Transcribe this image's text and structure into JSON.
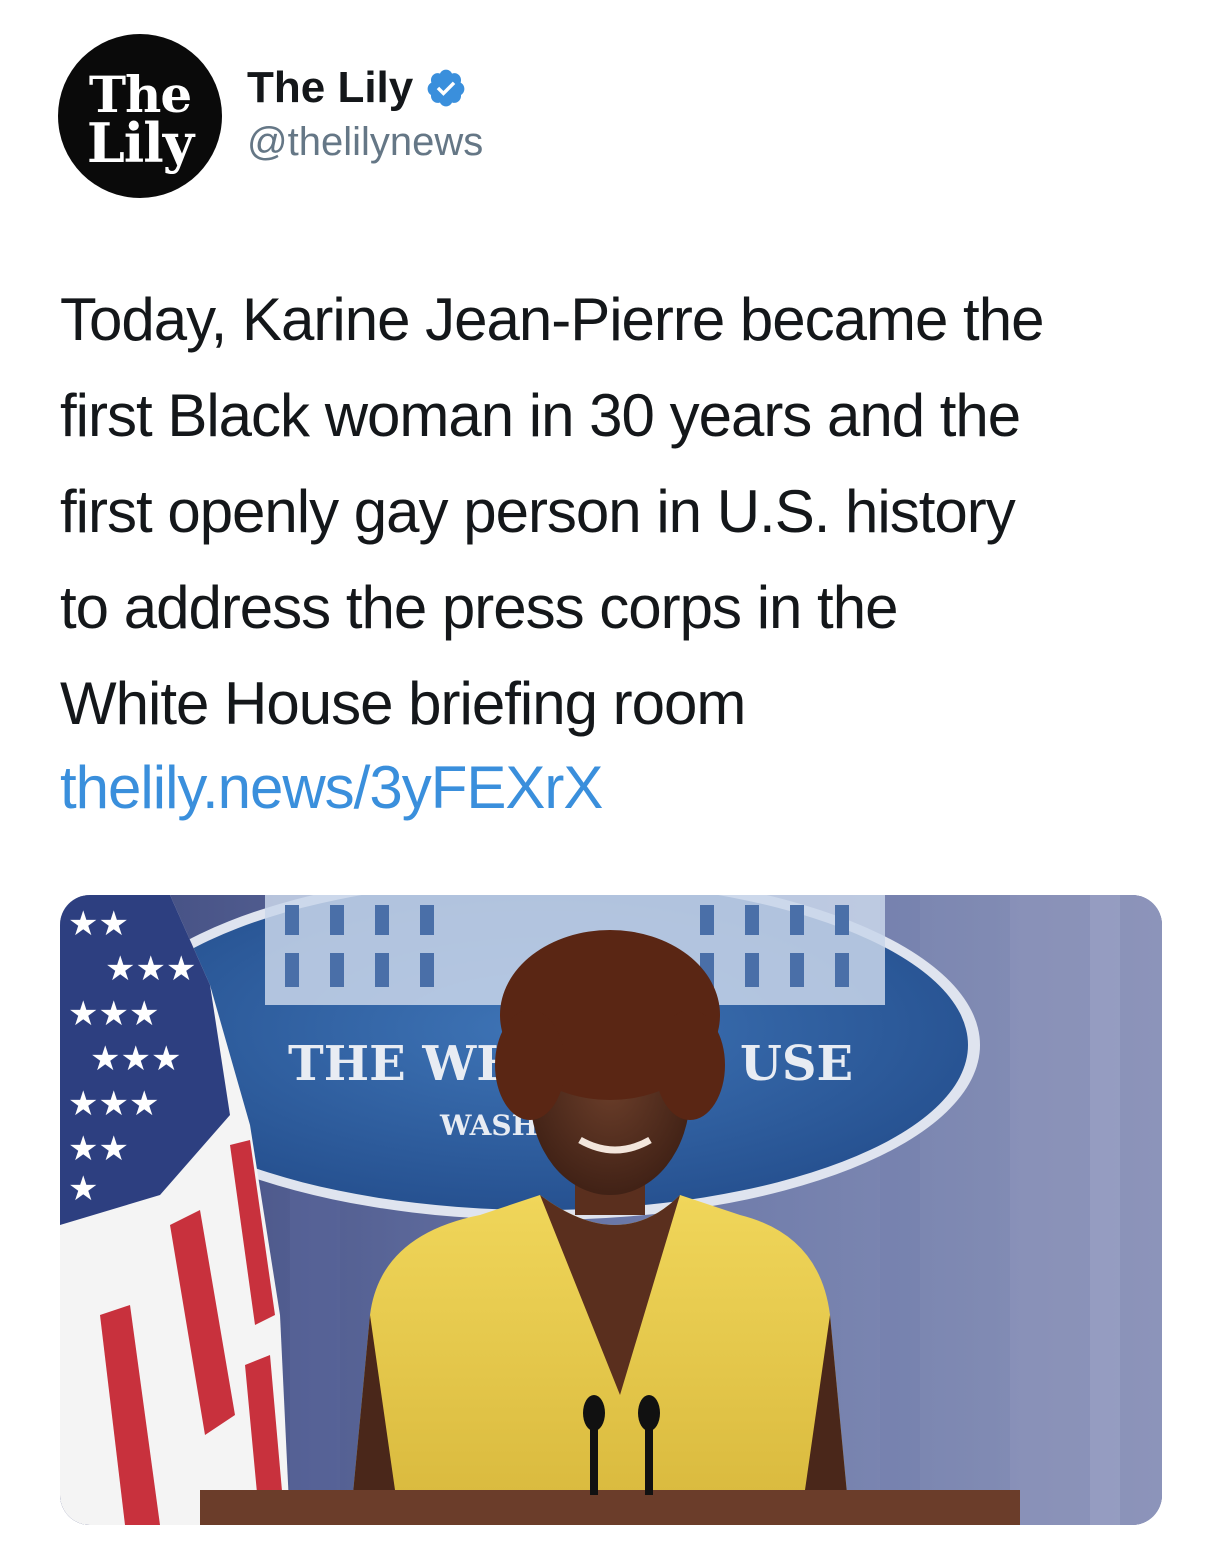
{
  "author": {
    "avatar_line1": "The",
    "avatar_line2": "Lily",
    "display_name": "The Lily",
    "handle": "@thelilynews",
    "verified": true
  },
  "tweet": {
    "text": "Today, Karine Jean-Pierre became the\nfirst Black woman in 30 years and the\nfirst openly gay person in U.S. history\nto address the press corps in the\nWhite House briefing room",
    "link": "thelily.news/3yFEXrX"
  },
  "media": {
    "seal_text_main": "THE WH",
    "seal_text_main_right": "USE",
    "seal_text_sub": "WASH"
  },
  "colors": {
    "link": "#3a8fdc",
    "verified_badge": "#3a8fdc",
    "handle": "#657786",
    "dress": "#e8c94a",
    "seal": "#2f5fa2"
  },
  "icons": {
    "verified": "verified-badge-icon"
  }
}
